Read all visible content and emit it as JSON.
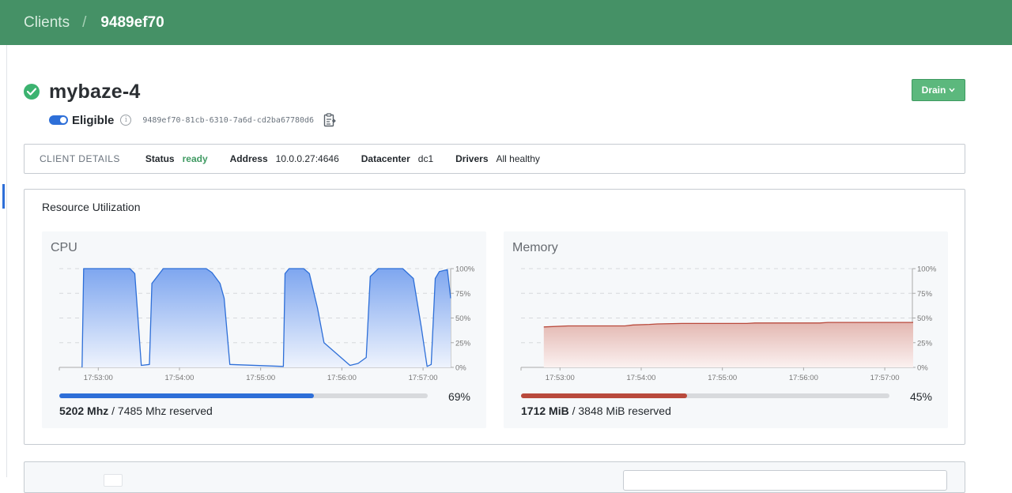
{
  "breadcrumb": {
    "root": "Clients",
    "separator": "/",
    "current": "9489ef70"
  },
  "header": {
    "title": "mybaze-4",
    "status_color": "#3cb370"
  },
  "drain_button": {
    "label": "Drain"
  },
  "eligibility": {
    "label": "Eligible",
    "enabled": true
  },
  "node_id": "9489ef70-81cb-6310-7a6d-cd2ba67780d6",
  "client_details": {
    "heading": "CLIENT DETAILS",
    "status_label": "Status",
    "status_value": "ready",
    "address_label": "Address",
    "address_value": "10.0.0.27:4646",
    "datacenter_label": "Datacenter",
    "datacenter_value": "dc1",
    "drivers_label": "Drivers",
    "drivers_value": "All healthy"
  },
  "resource_utilization": {
    "title": "Resource Utilization",
    "cpu": {
      "title": "CPU",
      "percent_label": "69%",
      "percent": 0.69,
      "used": "5202 Mhz",
      "reserved_text": "/ 7485 Mhz reserved",
      "color": "#2e6fd8"
    },
    "memory": {
      "title": "Memory",
      "percent_label": "45%",
      "percent": 0.45,
      "used": "1712 MiB",
      "reserved_text": "/ 3848 MiB reserved",
      "color": "#b94a3c"
    }
  },
  "allocations": {
    "search_placeholder": ""
  },
  "chart_data": [
    {
      "type": "area",
      "title": "CPU",
      "x_ticks": [
        "17:53:00",
        "17:54:00",
        "17:55:00",
        "17:56:00",
        "17:57:00"
      ],
      "y_ticks": [
        "100%",
        "75%",
        "50%",
        "25%",
        "0%"
      ],
      "ylim": [
        0,
        100
      ],
      "grid": true,
      "x_minutes": [
        0.8,
        0.82,
        1.39,
        1.45,
        1.53,
        1.63,
        1.66,
        1.8,
        2.33,
        2.4,
        2.5,
        2.55,
        2.62,
        3.28,
        3.3,
        3.35,
        3.45,
        3.53,
        3.6,
        3.7,
        3.78,
        4.1,
        4.2,
        4.3,
        4.35,
        4.45,
        4.48,
        4.62,
        4.75,
        4.88,
        4.98,
        5.05,
        5.1,
        5.15,
        5.2,
        5.3,
        5.34
      ],
      "values": [
        0,
        100,
        100,
        95,
        2,
        3,
        85,
        100,
        100,
        96,
        85,
        70,
        3,
        1,
        95,
        100,
        100,
        100,
        95,
        60,
        25,
        2,
        4,
        10,
        92,
        100,
        100,
        100,
        100,
        90,
        40,
        1,
        3,
        90,
        97,
        99,
        70
      ]
    },
    {
      "type": "area",
      "title": "Memory",
      "x_ticks": [
        "17:53:00",
        "17:54:00",
        "17:55:00",
        "17:56:00",
        "17:57:00"
      ],
      "y_ticks": [
        "100%",
        "75%",
        "50%",
        "25%",
        "0%"
      ],
      "ylim": [
        0,
        100
      ],
      "grid": true,
      "x_minutes": [
        0.8,
        1.1,
        1.8,
        1.9,
        2.1,
        2.2,
        2.5,
        2.6,
        3.3,
        3.4,
        3.5,
        3.6,
        4.2,
        4.3,
        4.7,
        4.8,
        5.3,
        5.35
      ],
      "values": [
        41,
        42,
        42,
        43,
        43.5,
        44,
        44.5,
        44.5,
        44.5,
        45,
        45,
        45,
        45,
        45.5,
        45.5,
        45.5,
        45.5,
        45.5
      ]
    }
  ]
}
